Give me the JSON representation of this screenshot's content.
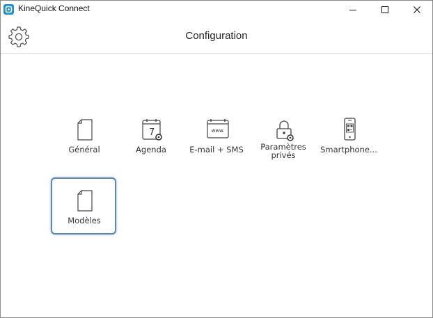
{
  "window": {
    "title": "KineQuick Connect",
    "accent": "#1e8fcf",
    "selection_border": "#5d86b8"
  },
  "header": {
    "title": "Configuration",
    "settings_icon": "gear-icon"
  },
  "tiles": [
    {
      "label": "Général",
      "icon": "document-icon"
    },
    {
      "label": "Agenda",
      "icon": "calendar-settings-icon",
      "calendar_day": "7"
    },
    {
      "label": "E-mail + SMS",
      "icon": "web-window-icon",
      "icon_text": "www."
    },
    {
      "label_line1": "Paramètres",
      "label_line2": "privés",
      "icon": "lock-settings-icon"
    },
    {
      "label": "Smartphone...",
      "icon": "smartphone-qr-icon"
    },
    {
      "label": "Modèles",
      "icon": "document-icon",
      "selected": true
    }
  ]
}
